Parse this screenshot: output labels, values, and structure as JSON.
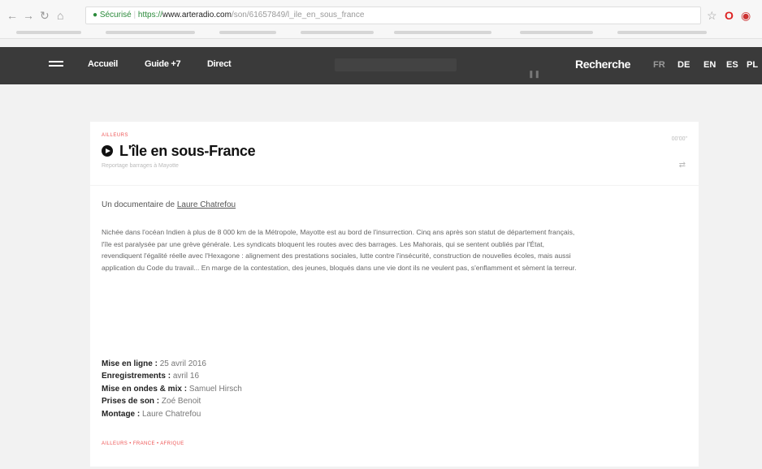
{
  "browser": {
    "back_icon": "back-arrow-icon",
    "secure_label": "Sécurisé",
    "url_https": "https://",
    "url_host": "www.arteradio.com",
    "url_path": "/son/61657849/l_ile_en_sous_france",
    "colors": {
      "secure": "#2a8a3a"
    }
  },
  "nav": {
    "links": [
      "Accueil",
      "Guide +7",
      "Direct"
    ],
    "search_label": "Recherche",
    "languages": [
      "FR",
      "DE",
      "EN",
      "ES",
      "PL"
    ]
  },
  "article": {
    "kicker": "AILLEURS",
    "title": "L'île en sous-France",
    "subtitle": "Reportage barrages à Mayotte",
    "duration": "00'00\"",
    "author_prefix": "Un documentaire de ",
    "author_name": "Laure Chatrefou",
    "description": "Nichée dans l'océan Indien à plus de 8 000 km de la Métropole, Mayotte est au bord de l'insurrection. Cinq ans après son statut de département français, l'île est paralysée par une grève générale. Les syndicats bloquent les routes avec des barrages. Les Mahorais, qui se sentent oubliés par l'État, revendiquent l'égalité réelle avec l'Hexagone : alignement des prestations sociales, lutte contre l'insécurité, construction de nouvelles écoles, mais aussi application du Code du travail... En marge de la contestation, des jeunes, bloqués dans une vie dont ils ne veulent pas, s'enflamment et sèment la terreur.",
    "meta": [
      {
        "label": "Mise en ligne",
        "value": "25 avril 2016"
      },
      {
        "label": "Enregistrements",
        "value": "avril 16"
      },
      {
        "label": "Mise en ondes & mix",
        "value": "Samuel Hirsch"
      },
      {
        "label": "Prises de son",
        "value": "Zoé Benoit"
      },
      {
        "label": "Montage",
        "value": "Laure Chatrefou"
      }
    ],
    "tags": "AILLEURS  •  FRANCE  •  AFRIQUE",
    "colors": {
      "accent": "#e55555"
    }
  }
}
